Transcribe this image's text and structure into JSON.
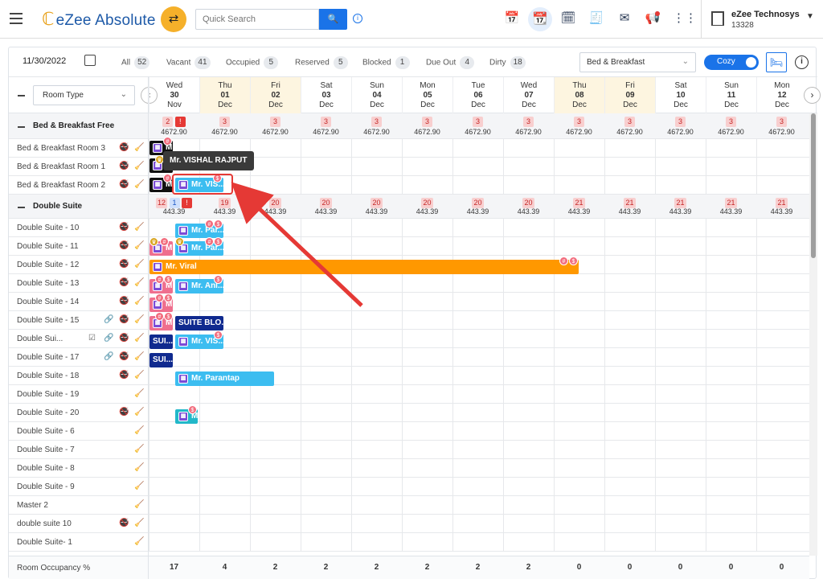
{
  "app": {
    "name": "eZee Absolute",
    "search_placeholder": "Quick Search",
    "property_name": "eZee Technosys",
    "property_id": "13328"
  },
  "filters": {
    "date": "11/30/2022",
    "chips": [
      {
        "label": "All",
        "count": "52"
      },
      {
        "label": "Vacant",
        "count": "41"
      },
      {
        "label": "Occupied",
        "count": "5"
      },
      {
        "label": "Reserved",
        "count": "5"
      },
      {
        "label": "Blocked",
        "count": "1"
      },
      {
        "label": "Due Out",
        "count": "4"
      },
      {
        "label": "Dirty",
        "count": "18"
      }
    ],
    "rate_plan": "Bed & Breakfast",
    "view_toggle": "Cozy",
    "room_type_select": "Room Type"
  },
  "dates": [
    {
      "dow": "Wed",
      "day": "30",
      "mon": "Nov",
      "weekend": false
    },
    {
      "dow": "Thu",
      "day": "01",
      "mon": "Dec",
      "weekend": true
    },
    {
      "dow": "Fri",
      "day": "02",
      "mon": "Dec",
      "weekend": true
    },
    {
      "dow": "Sat",
      "day": "03",
      "mon": "Dec",
      "weekend": false
    },
    {
      "dow": "Sun",
      "day": "04",
      "mon": "Dec",
      "weekend": false
    },
    {
      "dow": "Mon",
      "day": "05",
      "mon": "Dec",
      "weekend": false
    },
    {
      "dow": "Tue",
      "day": "06",
      "mon": "Dec",
      "weekend": false
    },
    {
      "dow": "Wed",
      "day": "07",
      "mon": "Dec",
      "weekend": false
    },
    {
      "dow": "Thu",
      "day": "08",
      "mon": "Dec",
      "weekend": true
    },
    {
      "dow": "Fri",
      "day": "09",
      "mon": "Dec",
      "weekend": true
    },
    {
      "dow": "Sat",
      "day": "10",
      "mon": "Dec",
      "weekend": false
    },
    {
      "dow": "Sun",
      "day": "11",
      "mon": "Dec",
      "weekend": false
    },
    {
      "dow": "Mon",
      "day": "12",
      "mon": "Dec",
      "weekend": false
    }
  ],
  "groups": [
    {
      "name": "Bed & Breakfast Free",
      "avail": [
        "2",
        "3",
        "3",
        "3",
        "3",
        "3",
        "3",
        "3",
        "3",
        "3",
        "3",
        "3",
        "3"
      ],
      "rates": [
        "4672.90",
        "4672.90",
        "4672.90",
        "4672.90",
        "4672.90",
        "4672.90",
        "4672.90",
        "4672.90",
        "4672.90",
        "4672.90",
        "4672.90",
        "4672.90",
        "4672.90"
      ],
      "rooms": [
        "Bed & Breakfast Room 3",
        "Bed & Breakfast Room 1",
        "Bed & Breakfast Room 2"
      ]
    },
    {
      "name": "Double Suite",
      "avail": [
        "12",
        "19",
        "20",
        "20",
        "20",
        "20",
        "20",
        "20",
        "21",
        "21",
        "21",
        "21",
        "21"
      ],
      "rates": [
        "443.39",
        "443.39",
        "443.39",
        "443.39",
        "443.39",
        "443.39",
        "443.39",
        "443.39",
        "443.39",
        "443.39",
        "443.39",
        "443.39",
        "443.39"
      ],
      "rooms": [
        "Double Suite - 10",
        "Double Suite - 11",
        "Double Suite - 12",
        "Double Suite - 13",
        "Double Suite - 14",
        "Double Suite - 15",
        "Double Sui...",
        "Double Suite - 17",
        "Double Suite - 18",
        "Double Suite - 19",
        "Double Suite - 20",
        "Double Suite - 6",
        "Double Suite - 7",
        "Double Suite - 8",
        "Double Suite - 9",
        "Master 2",
        "double suite 10",
        "Double Suite- 1"
      ]
    }
  ],
  "first_col_extra": {
    "blue": "1"
  },
  "bookings": {
    "vishal": "Mr. VIS...",
    "paran1": "Mr. Par...",
    "paran2": "Mr. Par...",
    "viral": "Mr. Viral",
    "ani": "Mr. Ani...",
    "suite_blo": "SUITE BLO...",
    "sui1": "SUI...",
    "vis2": "Mr. VIS...",
    "sui2": "SUI...",
    "parantap": "Mr. Parantap",
    "small_m": "M"
  },
  "tooltip": "Mr. VISHAL RAJPUT",
  "footer": {
    "label": "Room Occupancy %",
    "values": [
      "17",
      "4",
      "2",
      "2",
      "2",
      "2",
      "2",
      "2",
      "0",
      "0",
      "0",
      "0",
      "0"
    ]
  }
}
